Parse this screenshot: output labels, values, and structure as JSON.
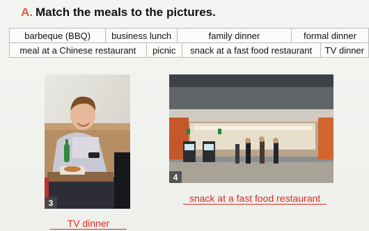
{
  "heading": {
    "letter": "A.",
    "text": "Match the meals to the pictures."
  },
  "vocabulary": {
    "row1": [
      "barbeque (BBQ)",
      "business lunch",
      "family dinner",
      "formal dinner"
    ],
    "row2": [
      "meal at a Chinese restaurant",
      "picnic",
      "snack at a fast food restaurant",
      "TV dinner"
    ]
  },
  "pictures": [
    {
      "number": "3",
      "answer": "TV dinner"
    },
    {
      "number": "4",
      "answer": "snack at a fast food restaurant"
    }
  ],
  "colors": {
    "heading_letter": "#e0603a",
    "answer_red": "#e0281e"
  }
}
